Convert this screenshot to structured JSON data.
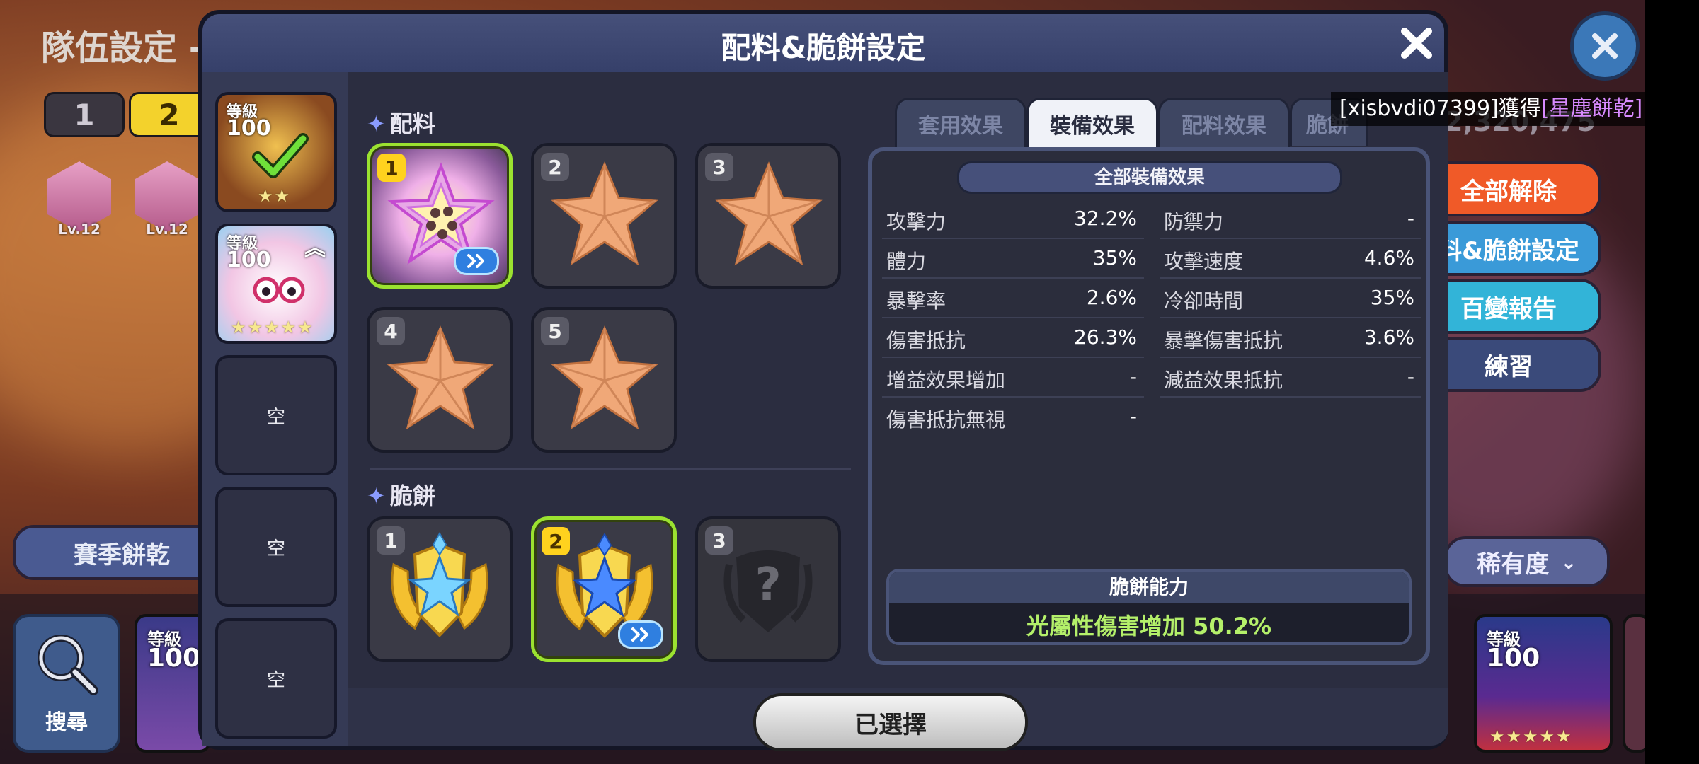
{
  "background": {
    "team_title": "隊伍設定 -",
    "team_tabs": [
      "1",
      "2"
    ],
    "treasures": [
      {
        "level": "Lv.12"
      },
      {
        "level": "Lv.12"
      }
    ],
    "season_button": "賽季餅乾",
    "search_label": "搜尋",
    "right_partial_number": "2,320,475",
    "side_buttons": {
      "unequip_all": "全部解除",
      "topping_setting": "料&脆餅設定",
      "report": "百變報告",
      "practice": "練習",
      "sort": "稀有度"
    },
    "bottom_cards": [
      {
        "level_label": "等級",
        "level": "100"
      },
      {
        "level_label": "等級",
        "level": "100"
      }
    ]
  },
  "modal": {
    "title": "配料&脆餅設定",
    "cookies": [
      {
        "level_label": "等級",
        "level": "100"
      },
      {
        "level_label": "等級",
        "level": "100"
      }
    ],
    "empty_label": "空",
    "toppings_label": "配料",
    "toppings": [
      {
        "index": "1",
        "equipped": true
      },
      {
        "index": "2",
        "equipped": false
      },
      {
        "index": "3",
        "equipped": false
      },
      {
        "index": "4",
        "equipped": false
      },
      {
        "index": "5",
        "equipped": false
      }
    ],
    "tarts_label": "脆餅",
    "tarts": [
      {
        "index": "1"
      },
      {
        "index": "2"
      },
      {
        "index": "3",
        "locked_symbol": "?"
      }
    ],
    "tabs": [
      "套用效果",
      "裝備效果",
      "配料效果",
      "脆餅"
    ],
    "active_tab": "裝備效果",
    "stats_title": "全部裝備效果",
    "stats": [
      {
        "key": "攻擊力",
        "value": "32.2%"
      },
      {
        "key": "防禦力",
        "value": "-"
      },
      {
        "key": "體力",
        "value": "35%"
      },
      {
        "key": "攻擊速度",
        "value": "4.6%"
      },
      {
        "key": "暴擊率",
        "value": "2.6%"
      },
      {
        "key": "冷卻時間",
        "value": "35%"
      },
      {
        "key": "傷害抵抗",
        "value": "26.3%"
      },
      {
        "key": "暴擊傷害抵抗",
        "value": "3.6%"
      },
      {
        "key": "增益效果增加",
        "value": "-"
      },
      {
        "key": "減益效果抵抗",
        "value": "-"
      },
      {
        "key": "傷害抵抗無視",
        "value": "-"
      }
    ],
    "ability_title": "脆餅能力",
    "ability_value": "光屬性傷害增加 50.2%",
    "select_button": "已選擇"
  },
  "toast": {
    "prefix": "[xisbvdi07399]獲得",
    "item": "[星塵餅乾]"
  },
  "colors": {
    "selected_border": "#9be230",
    "ability_text": "#b4f06a",
    "toast_item": "#d88aff"
  }
}
